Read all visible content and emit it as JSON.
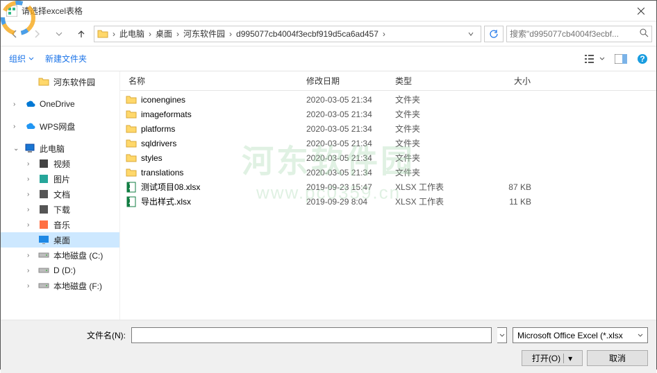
{
  "title": "请选择excel表格",
  "nav": {
    "breadcrumb": [
      "此电脑",
      "桌面",
      "河东软件园",
      "d995077cb4004f3ecbf919d5ca6ad457"
    ],
    "search_placeholder": "搜索\"d995077cb4004f3ecbf..."
  },
  "toolbar": {
    "organize": "组织",
    "newfolder": "新建文件夹"
  },
  "sidebar": {
    "items": [
      {
        "label": "河东软件园",
        "icon": "folder",
        "indent": true
      },
      {
        "label": "OneDrive",
        "icon": "onedrive",
        "caret": ">"
      },
      {
        "label": "WPS网盘",
        "icon": "wps",
        "caret": ">"
      },
      {
        "label": "此电脑",
        "icon": "pc",
        "caret": "v"
      },
      {
        "label": "视频",
        "icon": "video",
        "indent": true,
        "caret": ">"
      },
      {
        "label": "图片",
        "icon": "pictures",
        "indent": true,
        "caret": ">"
      },
      {
        "label": "文档",
        "icon": "documents",
        "indent": true,
        "caret": ">"
      },
      {
        "label": "下载",
        "icon": "downloads",
        "indent": true,
        "caret": ">"
      },
      {
        "label": "音乐",
        "icon": "music",
        "indent": true,
        "caret": ">"
      },
      {
        "label": "桌面",
        "icon": "desktop",
        "indent": true,
        "selected": true
      },
      {
        "label": "本地磁盘 (C:)",
        "icon": "drive",
        "indent": true,
        "caret": ">"
      },
      {
        "label": "D (D:)",
        "icon": "drive",
        "indent": true,
        "caret": ">"
      },
      {
        "label": "本地磁盘 (F:)",
        "icon": "drive",
        "indent": true,
        "caret": ">"
      }
    ]
  },
  "columns": {
    "name": "名称",
    "date": "修改日期",
    "type": "类型",
    "size": "大小"
  },
  "files": [
    {
      "name": "iconengines",
      "date": "2020-03-05 21:34",
      "type": "文件夹",
      "size": "",
      "icon": "folder"
    },
    {
      "name": "imageformats",
      "date": "2020-03-05 21:34",
      "type": "文件夹",
      "size": "",
      "icon": "folder"
    },
    {
      "name": "platforms",
      "date": "2020-03-05 21:34",
      "type": "文件夹",
      "size": "",
      "icon": "folder"
    },
    {
      "name": "sqldrivers",
      "date": "2020-03-05 21:34",
      "type": "文件夹",
      "size": "",
      "icon": "folder"
    },
    {
      "name": "styles",
      "date": "2020-03-05 21:34",
      "type": "文件夹",
      "size": "",
      "icon": "folder"
    },
    {
      "name": "translations",
      "date": "2020-03-05 21:34",
      "type": "文件夹",
      "size": "",
      "icon": "folder"
    },
    {
      "name": "测试项目08.xlsx",
      "date": "2019-09-23 15:47",
      "type": "XLSX 工作表",
      "size": "87 KB",
      "icon": "xlsx"
    },
    {
      "name": "导出样式.xlsx",
      "date": "2019-09-29 8:04",
      "type": "XLSX 工作表",
      "size": "11 KB",
      "icon": "xlsx"
    }
  ],
  "footer": {
    "filename_label": "文件名(N):",
    "filetype": "Microsoft Office Excel (*.xlsx",
    "open": "打开(O)",
    "cancel": "取消"
  },
  "watermark": {
    "line1": "河东软件园",
    "line2": "www.pc0359.cn"
  }
}
